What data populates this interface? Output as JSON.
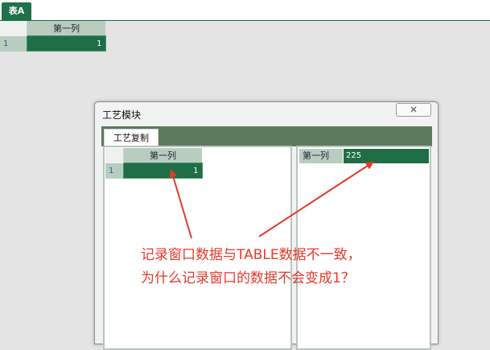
{
  "sheet": {
    "tab_label": "表A",
    "column_header": "第一列",
    "row_number": "1",
    "cell_value": "1"
  },
  "dialog": {
    "title": "工艺模块",
    "close_icon": "close-icon",
    "tab_label": "工艺复制",
    "left_grid": {
      "column_header": "第一列",
      "row_number": "1",
      "cell_value": "1"
    },
    "right_record": {
      "field_label": "第一列",
      "field_value": "225"
    }
  },
  "annotation": {
    "line1": "记录窗口数据与TABLE数据不一致，",
    "line2": "为什么记录窗口的数据不会变成1？",
    "color": "#e53a2c"
  },
  "colors": {
    "accent_green": "#1f6e45",
    "header_green": "#b8cdc0",
    "tabstrip_green": "#5d7a5f"
  }
}
